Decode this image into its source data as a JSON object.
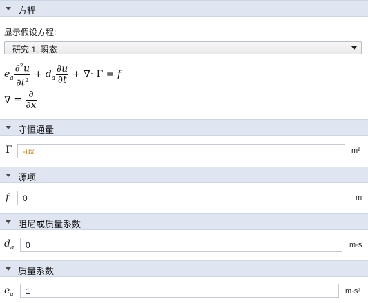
{
  "sections": {
    "equation": {
      "title": "方程"
    },
    "conservative_flux": {
      "title": "守恒通量"
    },
    "source": {
      "title": "源项"
    },
    "damping": {
      "title": "阻尼或质量系数"
    },
    "mass": {
      "title": "质量系数"
    }
  },
  "equation": {
    "show_label": "显示假设方程:",
    "study_select": "研究 1, 瞬态",
    "formula_main": "e_a ∂²u/∂t² + d_a ∂u/∂t + ∇·Γ = f",
    "formula_nabla": "∇ = ∂/∂x"
  },
  "fields": {
    "gamma": {
      "symbol": "Γ",
      "value": "-ux",
      "unit": "m²",
      "value_color": "#c9881a"
    },
    "f": {
      "symbol": "f",
      "value": "0",
      "unit": "m"
    },
    "da": {
      "symbol": "d",
      "sub": "a",
      "value": "0",
      "unit": "m·s"
    },
    "ea": {
      "symbol": "e",
      "sub": "a",
      "value": "1",
      "unit": "m·s²"
    }
  }
}
